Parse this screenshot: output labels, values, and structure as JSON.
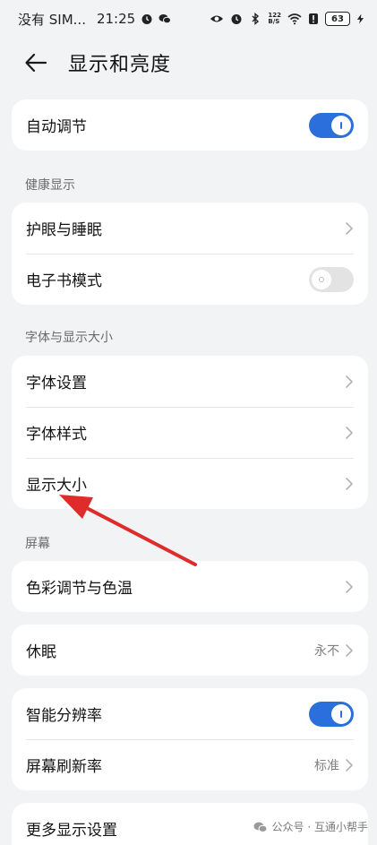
{
  "status_bar": {
    "carrier": "没有 SIM...",
    "time": "21:25",
    "net_speed_top": "122",
    "net_speed_bottom": "B/S",
    "battery": "63"
  },
  "header": {
    "title": "显示和亮度"
  },
  "auto_adjust": {
    "label": "自动调节",
    "toggle": "on"
  },
  "health_section": {
    "title": "健康显示",
    "items": [
      {
        "label": "护眼与睡眠"
      },
      {
        "label": "电子书模式",
        "toggle": "off"
      }
    ]
  },
  "font_section": {
    "title": "字体与显示大小",
    "items": [
      {
        "label": "字体设置"
      },
      {
        "label": "字体样式"
      },
      {
        "label": "显示大小"
      }
    ]
  },
  "screen_section": {
    "title": "屏幕",
    "color": {
      "label": "色彩调节与色温"
    },
    "sleep": {
      "label": "休眠",
      "value": "永不"
    },
    "resolution": {
      "label": "智能分辨率",
      "toggle": "on"
    },
    "refresh": {
      "label": "屏幕刷新率",
      "value": "标准"
    }
  },
  "more": {
    "label": "更多显示设置"
  },
  "watermark": {
    "text": "公众号 · 互通小帮手"
  },
  "colors": {
    "accent": "#2a6fdb",
    "annotation_arrow": "#e02b2b",
    "background": "#f1f3f5"
  }
}
